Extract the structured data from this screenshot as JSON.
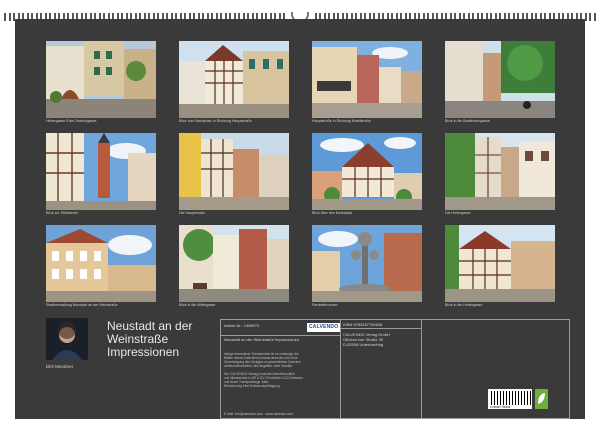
{
  "captions": [
    "Hintergasse Ecke Zwerchgasse",
    "Blick vom Marktplatz in Richtung Hauptstraße",
    "Hauptstraße in Richtung Marktstraße",
    "Blick in die Badstubengasse",
    "Blick zur Stiftskirche",
    "Die Hauptstraße",
    "Blick über den Marktplatz",
    "Die Hintergasse",
    "Stadtverwaltung Neustadt an der Weinstraße",
    "Blick in die Mittelgasse",
    "Parabelbrunnen",
    "Blick in die Hintergasse"
  ],
  "author": {
    "name": "Dirk Meutzner"
  },
  "title": {
    "line1": "Neustadt an der",
    "line2": "Weinstraße",
    "line3": "Impressionen"
  },
  "info": {
    "article": "Artikel-Nr.: 1988973",
    "logo": "CALVENDO",
    "subtitle": "Neustadt an der Weinstraße Impressionen",
    "desc1": "Infolge besonderer Schutzrechte ist es untersagt, die",
    "desc2": "Blätter dieses Kalenders herauszutrennen und ohne",
    "desc3": "Genehmigung des Verlages zu gewerblichen Zwecken",
    "desc4": "weiterzuverarbeiten. Alle Angaben ohne Gewähr.",
    "prod1": "Der CALVENDO-Verlag produziert klimafreundlich",
    "prod2": "und klimaneutral in DE & EU. Produktion CO2-Emission",
    "prod3": "und durch Transportwege. Aktiv.",
    "prod4": "Reduzierung eine Emissionsauftragung.",
    "contact": "E-Mail: info@calvendo.com · www.calvendo.com",
    "isbn": "ISBN 9783457750636",
    "publisher1": "CALVENDO Verlag GmbH",
    "publisher2": "Ottobrunner Straße 39",
    "publisher3": "D-82008 Unterhaching",
    "barcode_number": "9 783457 750636"
  },
  "colors": {
    "sheet": "#3a3a3a",
    "text": "#e8e8e8",
    "accent_logo": "#1a4d9c",
    "eco_badge": "#6fae3d"
  },
  "icons": [
    "author-portrait",
    "calvendo-logo",
    "barcode",
    "eco-leaf-icon"
  ]
}
